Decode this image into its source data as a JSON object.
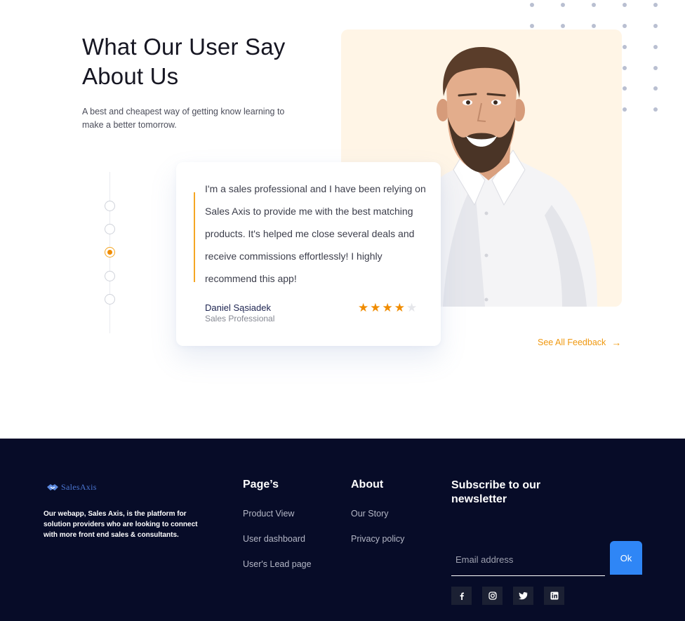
{
  "testimonial_section": {
    "heading": "What Our User Say About Us",
    "subtext": "A best and cheapest way of getting know learning to make a better tomorrow.",
    "quote": "I'm a sales professional and I have been relying on Sales Axis to provide me with the best matching products. It's helped me close several deals and receive commissions effortlessly! I highly recommend this app!",
    "author_name": "Daniel Sąsiadek",
    "author_role": "Sales Professional",
    "rating": 4,
    "rating_max": 5,
    "active_slide": 3,
    "slide_count": 5,
    "see_all_label": "See All Feedback",
    "see_all_icon": "arrow-right-icon"
  },
  "colors": {
    "accent_orange": "#f08c00",
    "photo_bg": "#fff5e6",
    "footer_bg": "#070c28",
    "ok_button": "#2f86f6"
  },
  "footer": {
    "logo_text": "SalesAxis",
    "about_text": "Our webapp, Sales Axis, is the platform for solution providers who are looking to connect with more front end sales & consultants.",
    "pages": {
      "title": "Page’s",
      "links": [
        "Product View",
        "User dashboard",
        "User's Lead page"
      ]
    },
    "about": {
      "title": "About",
      "links": [
        "Our Story",
        "Privacy policy"
      ]
    },
    "newsletter": {
      "title": "Subscribe to our newsletter",
      "email_placeholder": "Email address",
      "button_label": "Ok"
    },
    "social_icons": [
      "facebook-icon",
      "instagram-icon",
      "twitter-icon",
      "linkedin-icon"
    ]
  }
}
